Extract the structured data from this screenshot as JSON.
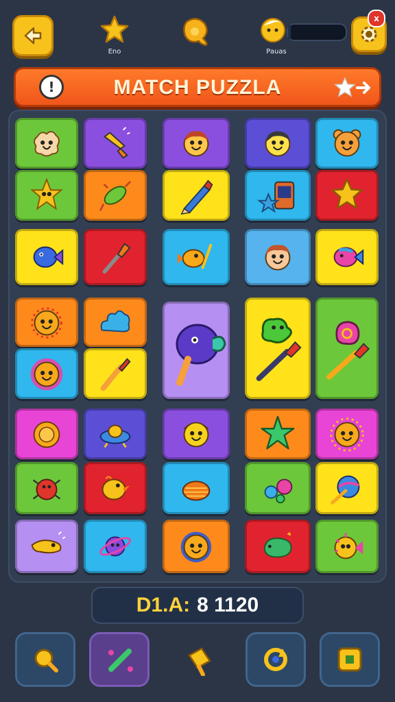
{
  "top_bar": {
    "back_icon": "back-arrow-icon",
    "star_label": "Eno",
    "coin_icon": "coin-icon",
    "avatar_label": "Pauas",
    "progress_fraction": 0.05,
    "settings_badge": "x"
  },
  "banner": {
    "info_glyph": "!",
    "title": "MATCH PUZZLA"
  },
  "score": {
    "label": "D1.A:",
    "value": "8 1120"
  },
  "colors": {
    "green": "#6cc83a",
    "purple": "#8b4fe0",
    "blue": "#2fb7ee",
    "orange": "#ff8a1c",
    "yellow": "#ffe21a",
    "red": "#e0232e",
    "magenta": "#e845d6",
    "lavender": "#b58ff2",
    "skyblue": "#56b3ee",
    "indigo": "#5b4fd6"
  },
  "tiles": [
    {
      "name": "tile-cookie-face",
      "color": "green",
      "icon": "cookie-face"
    },
    {
      "name": "tile-rocket",
      "color": "purple",
      "icon": "rocket"
    },
    {
      "name": "tile-girl-face",
      "color": "purple",
      "icon": "girl-face"
    },
    {
      "name": "tile-boy-face",
      "color": "indigo",
      "icon": "boy-face"
    },
    {
      "name": "tile-bear-face",
      "color": "blue",
      "icon": "bear-face"
    },
    {
      "name": "tile-starfish",
      "color": "green",
      "icon": "starfish"
    },
    {
      "name": "tile-candy-rocket",
      "color": "orange",
      "icon": "candy-rocket"
    },
    {
      "name": "tile-crayon",
      "color": "yellow",
      "icon": "crayon"
    },
    {
      "name": "tile-star-tv",
      "color": "blue",
      "icon": "star-tv"
    },
    {
      "name": "tile-star",
      "color": "red",
      "icon": "star"
    },
    {
      "name": "tile-fish",
      "color": "yellow",
      "icon": "fish"
    },
    {
      "name": "tile-torch",
      "color": "red",
      "icon": "torch"
    },
    {
      "name": "tile-fish-wand",
      "color": "blue",
      "icon": "fish-wand"
    },
    {
      "name": "tile-kid-face",
      "color": "skyblue",
      "icon": "kid-face"
    },
    {
      "name": "tile-rainbow-fish",
      "color": "yellow",
      "icon": "rainbow-fish"
    },
    {
      "name": "tile-sun-face",
      "color": "orange",
      "icon": "sun-face"
    },
    {
      "name": "tile-blue-cloud",
      "color": "orange",
      "icon": "blue-cloud"
    },
    {
      "name": "tile-big-lollipop-fish",
      "color": "lavender",
      "icon": "lollipop-fish"
    },
    {
      "name": "tile-big-green-blob",
      "color": "yellow",
      "icon": "green-blob-brush"
    },
    {
      "name": "tile-big-snail-brush",
      "color": "green",
      "icon": "snail-brush"
    },
    {
      "name": "tile-flower-face",
      "color": "blue",
      "icon": "flower-face"
    },
    {
      "name": "tile-paintbrush",
      "color": "yellow",
      "icon": "paintbrush"
    },
    {
      "name": "tile-orange-ball",
      "color": "magenta",
      "icon": "orange-ball"
    },
    {
      "name": "tile-ufo",
      "color": "indigo",
      "icon": "ufo"
    },
    {
      "name": "tile-yellow-chick",
      "color": "purple",
      "icon": "yellow-chick"
    },
    {
      "name": "tile-green-star",
      "color": "orange",
      "icon": "green-star"
    },
    {
      "name": "tile-sunny-face",
      "color": "magenta",
      "icon": "sunny-face"
    },
    {
      "name": "tile-red-bug",
      "color": "green",
      "icon": "red-bug"
    },
    {
      "name": "tile-bird",
      "color": "red",
      "icon": "bird"
    },
    {
      "name": "tile-shell",
      "color": "blue",
      "icon": "shell"
    },
    {
      "name": "tile-bubbles",
      "color": "green",
      "icon": "bubbles"
    },
    {
      "name": "tile-planet-brush",
      "color": "yellow",
      "icon": "planet-brush"
    },
    {
      "name": "tile-flying-fish",
      "color": "lavender",
      "icon": "flying-fish"
    },
    {
      "name": "tile-saturn",
      "color": "blue",
      "icon": "saturn"
    },
    {
      "name": "tile-lion-face",
      "color": "orange",
      "icon": "lion-face"
    },
    {
      "name": "tile-green-dino",
      "color": "red",
      "icon": "green-dino"
    },
    {
      "name": "tile-puffer-fish",
      "color": "green",
      "icon": "puffer-fish"
    }
  ],
  "bottom_bar": [
    {
      "name": "hint-button",
      "icon": "magnifier-icon"
    },
    {
      "name": "shuffle-button",
      "icon": "wand-icon",
      "active": true
    },
    {
      "name": "hammer-button",
      "icon": "hammer-icon"
    },
    {
      "name": "refresh-button",
      "icon": "refresh-icon"
    },
    {
      "name": "menu-button",
      "icon": "square-icon"
    }
  ]
}
